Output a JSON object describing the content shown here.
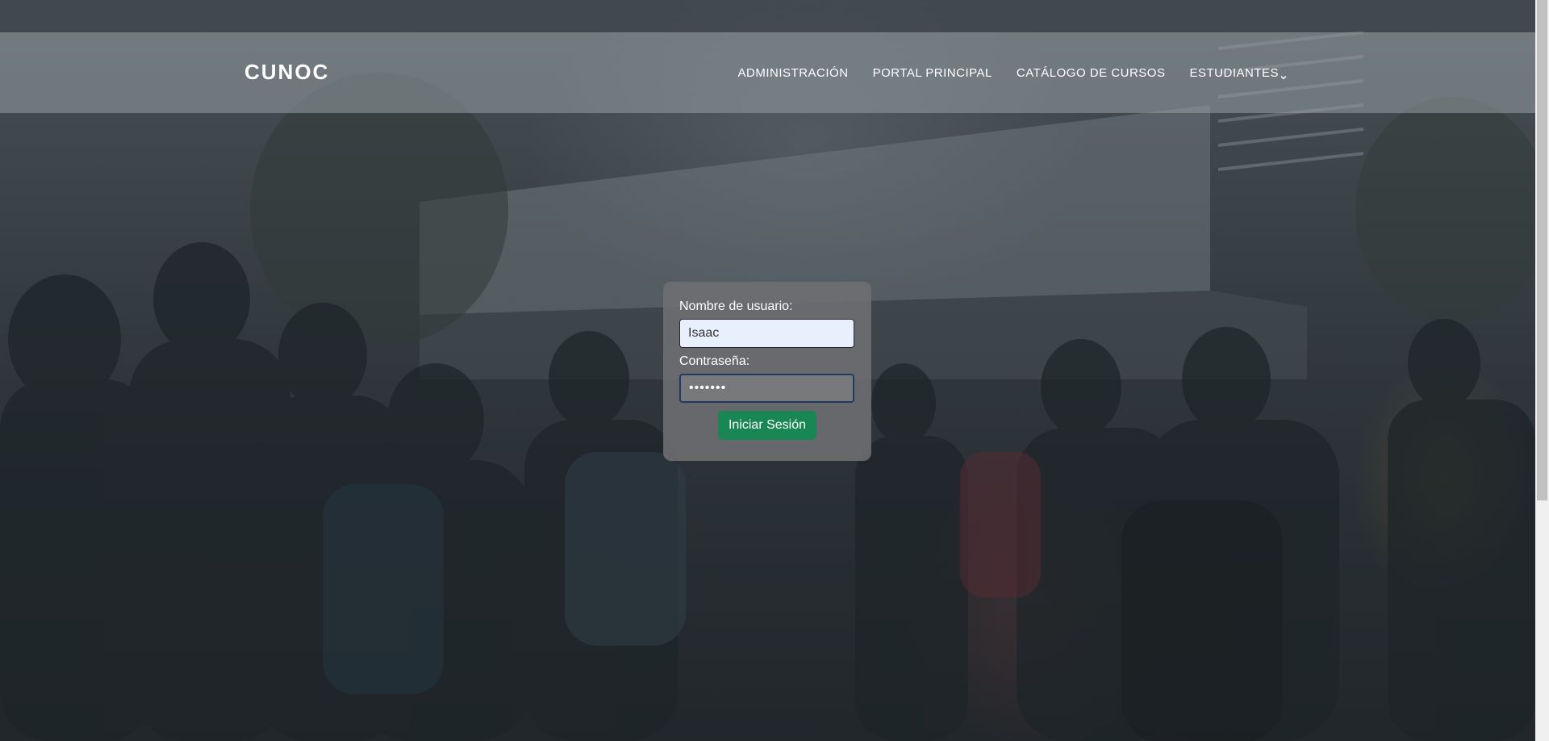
{
  "navbar": {
    "brand": "CUNOC",
    "items": [
      {
        "label": "ADMINISTRACIÓN"
      },
      {
        "label": "PORTAL PRINCIPAL"
      },
      {
        "label": "CATÁLOGO DE CURSOS"
      },
      {
        "label": "ESTUDIANTES",
        "icon": "chevron-down-icon"
      }
    ]
  },
  "login": {
    "username_label": "Nombre de usuario:",
    "username_value": "Isaac",
    "password_label": "Contraseña:",
    "password_value": "•••••••",
    "submit_label": "Iniciar Sesión"
  },
  "colors": {
    "button": "#198754",
    "focus_border": "#1f3b63",
    "autofill_bg": "#e8f0fe"
  }
}
